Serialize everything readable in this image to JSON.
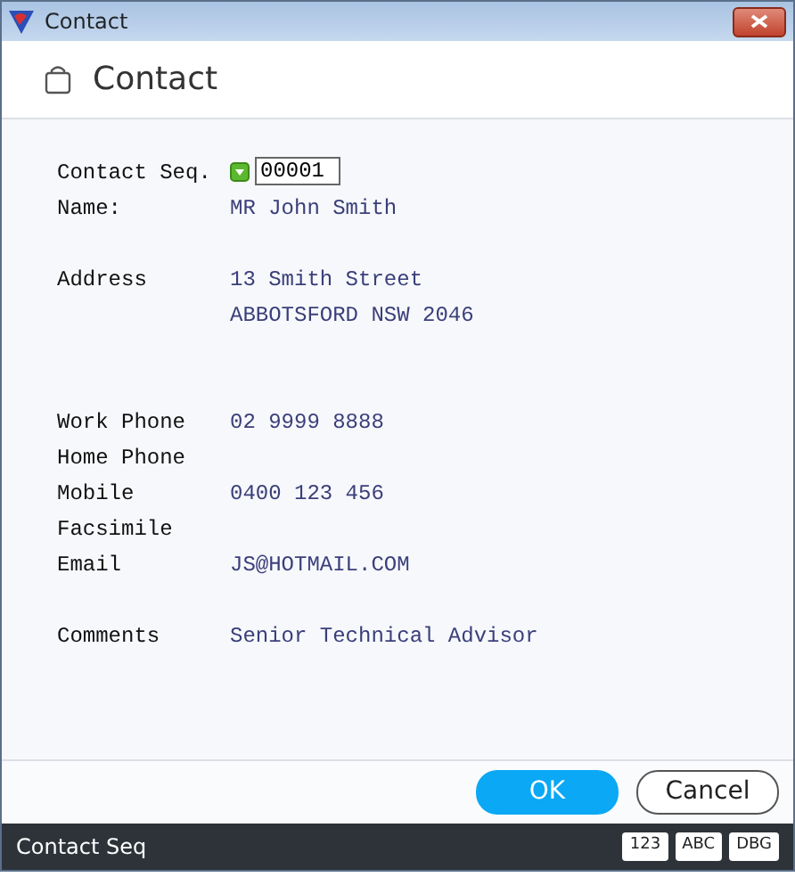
{
  "window": {
    "title": "Contact"
  },
  "header": {
    "title": "Contact"
  },
  "sections": [
    {
      "rows": [
        {
          "label": "Contact Seq.",
          "kind": "field",
          "value": "00001"
        },
        {
          "label": "Name:",
          "kind": "text",
          "lines": [
            "MR John Smith"
          ]
        }
      ]
    },
    {
      "rows": [
        {
          "label": "Address",
          "kind": "text",
          "lines": [
            "13 Smith Street",
            "ABBOTSFORD NSW 2046"
          ]
        }
      ]
    },
    {
      "rows": [
        {
          "label": "Work Phone",
          "kind": "text",
          "lines": [
            "02 9999 8888"
          ]
        },
        {
          "label": "Home Phone",
          "kind": "text"
        },
        {
          "label": "Mobile",
          "kind": "text",
          "lines": [
            "0400 123 456"
          ]
        },
        {
          "label": "Facsimile",
          "kind": "text"
        },
        {
          "label": "Email",
          "kind": "text",
          "lines": [
            "JS@HOTMAIL.COM"
          ]
        }
      ]
    },
    {
      "rows": [
        {
          "label": "Comments",
          "kind": "text",
          "lines": [
            "Senior Technical Advisor"
          ]
        }
      ]
    }
  ],
  "buttons": [
    {
      "label": "OK",
      "kind": "primary"
    },
    {
      "label": "Cancel",
      "kind": "secondary"
    }
  ],
  "status_bar": {
    "text": "Contact Seq",
    "indicators": [
      "123",
      "ABC",
      "DBG"
    ]
  }
}
